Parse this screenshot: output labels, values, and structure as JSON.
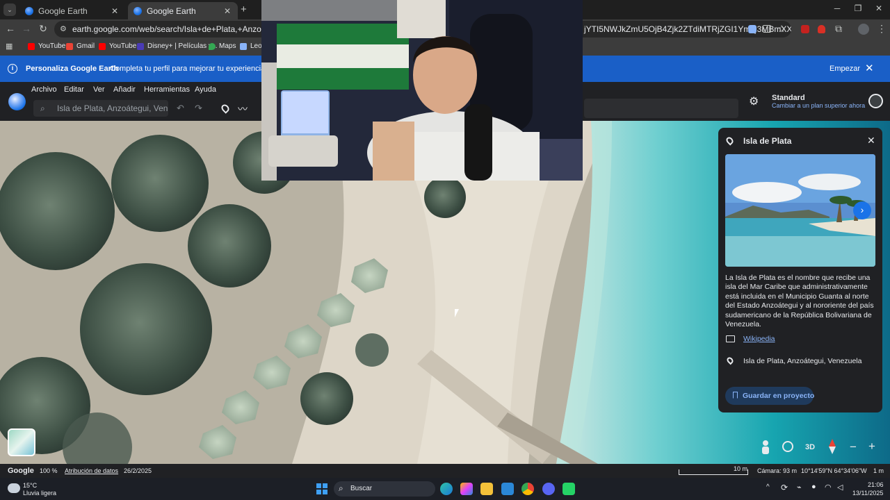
{
  "browser": {
    "tabs": [
      {
        "title": "Google Earth",
        "active": false
      },
      {
        "title": "Google Earth",
        "active": true
      }
    ],
    "url_visible_left": "earth.google.com/web/search/Isla+de+Plata,+Anzoátegui,+Venez",
    "url_visible_right": "jYTI5NWJkZmU5OjB4Zjk2ZTdiMTRjZGI1YmQ3MBmXX...",
    "bookmarks": [
      {
        "label": "YouTube",
        "color": "#ff0000"
      },
      {
        "label": "Gmail",
        "color": "#ea4335"
      },
      {
        "label": "YouTube",
        "color": "#ff0000"
      },
      {
        "label": "Disney+ | Películas y...",
        "color": "#4a3bb5"
      },
      {
        "label": "Maps",
        "color": "#34a853"
      },
      {
        "label": "Leon",
        "color": "#5f6368"
      }
    ]
  },
  "banner": {
    "title": "Personaliza Google Earth",
    "text": "Completa tu perfil para mejorar tu experiencia",
    "action": "Empezar"
  },
  "menubar": {
    "items": [
      "Archivo",
      "Editar",
      "Ver",
      "Añadir",
      "Herramientas",
      "Ayuda"
    ],
    "search_value": "Isla de Plata, Anzoátegui, Venezu",
    "plan_title": "Standard",
    "plan_link": "Cambiar a un plan superior ahora"
  },
  "panel": {
    "title": "Isla de Plata",
    "description": "La Isla de Plata es el nombre que recibe una isla del Mar Caribe que administrativamente está incluida en el Municipio Guanta al norte del Estado Anzoátegui y al nororiente del país sudamericano de la República Bolivariana de Venezuela.",
    "source_link": "Wikipedia",
    "address": "Isla de Plata, Anzoátegui, Venezuela",
    "save_button": "Guardar en proyecto"
  },
  "map_controls": {
    "mode_3d": "3D"
  },
  "statusbar": {
    "brand": "Google",
    "zoom": "100 %",
    "attribution": "Atribución de datos",
    "date": "26/2/2025",
    "scale": "10 m",
    "camera": "Cámara: 93 m",
    "coords": "10°14'59\"N 64°34'06\"W",
    "elevation": "1 m"
  },
  "taskbar": {
    "weather_temp": "15°C",
    "weather_desc": "Lluvia ligera",
    "search_placeholder": "Buscar",
    "time": "21:06",
    "date": "13/11/2025"
  },
  "colors": {
    "accent": "#8ab4f8",
    "banner": "#1a5fc7",
    "panel_bg": "#202124",
    "save_button_bg": "#1f3a5c"
  }
}
